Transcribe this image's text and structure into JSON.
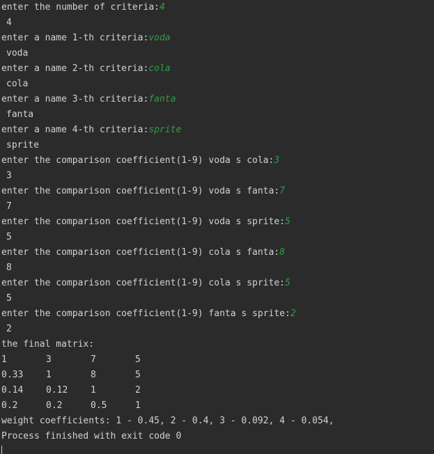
{
  "console": {
    "lines": [
      {
        "prompt": "enter the number of criteria:",
        "input": "4"
      },
      {
        "echo": "4"
      },
      {
        "prompt": "enter a name 1-th criteria:",
        "input": "voda"
      },
      {
        "echo": "voda"
      },
      {
        "prompt": "enter a name 2-th criteria:",
        "input": "cola"
      },
      {
        "echo": "cola"
      },
      {
        "prompt": "enter a name 3-th criteria:",
        "input": "fanta"
      },
      {
        "echo": "fanta"
      },
      {
        "prompt": "enter a name 4-th criteria:",
        "input": "sprite"
      },
      {
        "echo": "sprite"
      },
      {
        "prompt": "enter the comparison coefficient(1-9) voda s cola:",
        "input": "3"
      },
      {
        "echo": "3"
      },
      {
        "prompt": "enter the comparison coefficient(1-9) voda s fanta:",
        "input": "7"
      },
      {
        "echo": "7"
      },
      {
        "prompt": "enter the comparison coefficient(1-9) voda s sprite:",
        "input": "5"
      },
      {
        "echo": "5"
      },
      {
        "prompt": "enter the comparison coefficient(1-9) cola s fanta:",
        "input": "8"
      },
      {
        "echo": "8"
      },
      {
        "prompt": "enter the comparison coefficient(1-9) cola s sprite:",
        "input": "5"
      },
      {
        "echo": "5"
      },
      {
        "prompt": "enter the comparison coefficient(1-9) fanta s sprite:",
        "input": "2"
      },
      {
        "echo": "2"
      }
    ],
    "matrix_title": "the final matrix:",
    "matrix": [
      [
        "1",
        "3",
        "7",
        "5"
      ],
      [
        "0.33",
        "1",
        "8",
        "5"
      ],
      [
        "0.14",
        "0.12",
        "1",
        "2"
      ],
      [
        "0.2",
        "0.2",
        "0.5",
        "1"
      ]
    ],
    "weights": "weight coefficients: 1 - 0.45, 2 - 0.4, 3 - 0.092, 4 - 0.054,",
    "exit_message": "Process finished with exit code 0"
  },
  "colors": {
    "background": "#2b2b2b",
    "output_text": "#cfd3d8",
    "user_input": "#2f9e44"
  }
}
